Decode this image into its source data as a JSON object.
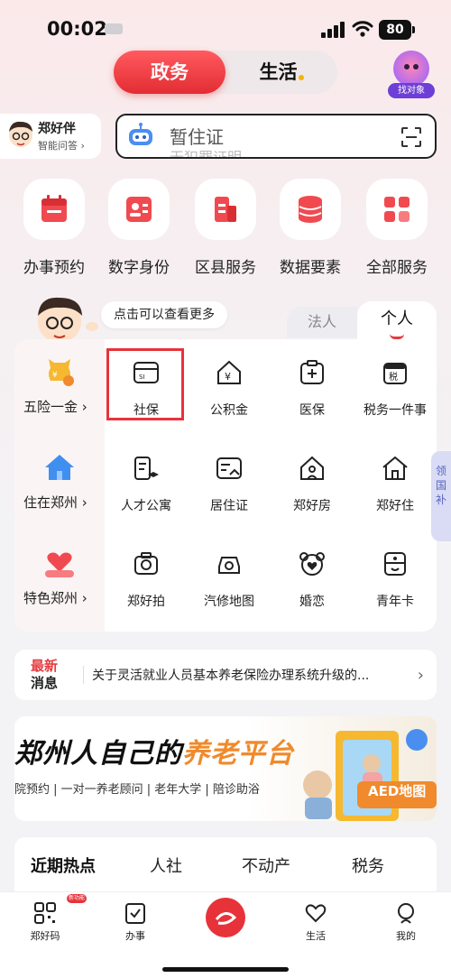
{
  "status_bar": {
    "time": "00:02",
    "battery": "80"
  },
  "top_switch": {
    "active": "政务",
    "inactive": "生活"
  },
  "match_button": {
    "label": "找对象"
  },
  "assistant": {
    "name": "郑好伴",
    "subtitle": "智能问答 ›"
  },
  "search": {
    "placeholder": "暂住证",
    "placeholder_next": "无犯罪证明"
  },
  "quick_services": [
    {
      "label": "办事预约",
      "icon": "calendar-icon"
    },
    {
      "label": "数字身份",
      "icon": "id-card-icon"
    },
    {
      "label": "区县服务",
      "icon": "building-icon"
    },
    {
      "label": "数据要素",
      "icon": "database-icon"
    },
    {
      "label": "全部服务",
      "icon": "grid-icon"
    }
  ],
  "service_card": {
    "hint": "点击可以查看更多",
    "tab_legal": "法人",
    "tab_personal": "个人",
    "categories": [
      {
        "label": "五险一金 ›",
        "icon": "piggy-bank-icon"
      },
      {
        "label": "住在郑州 ›",
        "icon": "house-icon"
      },
      {
        "label": "特色郑州 ›",
        "icon": "heart-hands-icon"
      }
    ],
    "rows": [
      [
        {
          "label": "社保",
          "icon": "social-security-card-icon"
        },
        {
          "label": "公积金",
          "icon": "yuan-house-icon"
        },
        {
          "label": "医保",
          "icon": "medical-insurance-icon"
        },
        {
          "label": "税务一件事",
          "icon": "tax-icon"
        }
      ],
      [
        {
          "label": "人才公寓",
          "icon": "talent-apartment-icon"
        },
        {
          "label": "居住证",
          "icon": "residence-permit-icon"
        },
        {
          "label": "郑好房",
          "icon": "house-pin-icon"
        },
        {
          "label": "郑好住",
          "icon": "home-icon"
        }
      ],
      [
        {
          "label": "郑好拍",
          "icon": "camera-icon"
        },
        {
          "label": "汽修地图",
          "icon": "car-repair-icon"
        },
        {
          "label": "婚恋",
          "icon": "bear-heart-icon"
        },
        {
          "label": "青年卡",
          "icon": "youth-card-icon"
        }
      ]
    ],
    "side_tab": "领国补"
  },
  "news": {
    "badge_top": "最新",
    "badge_bottom": "消息",
    "text": "关于灵活就业人员基本养老保险办理系统升级的..."
  },
  "banner": {
    "title_prefix": "郑州人自己的",
    "title_highlight": "养老平台",
    "subtitle": "院预约 | 一对一养老顾问 | 老年大学 | 陪诊助浴",
    "aed": "AED地图"
  },
  "hot_topics": {
    "tabs": [
      "近期热点",
      "人社",
      "不动产",
      "税务"
    ]
  },
  "bottom_nav": {
    "items": [
      "郑好码",
      "办事",
      "",
      "生活",
      "我的"
    ],
    "tag": "新功能"
  },
  "colors": {
    "accent": "#e8323a",
    "orange": "#f08a2c",
    "side": "#5a66c0"
  }
}
